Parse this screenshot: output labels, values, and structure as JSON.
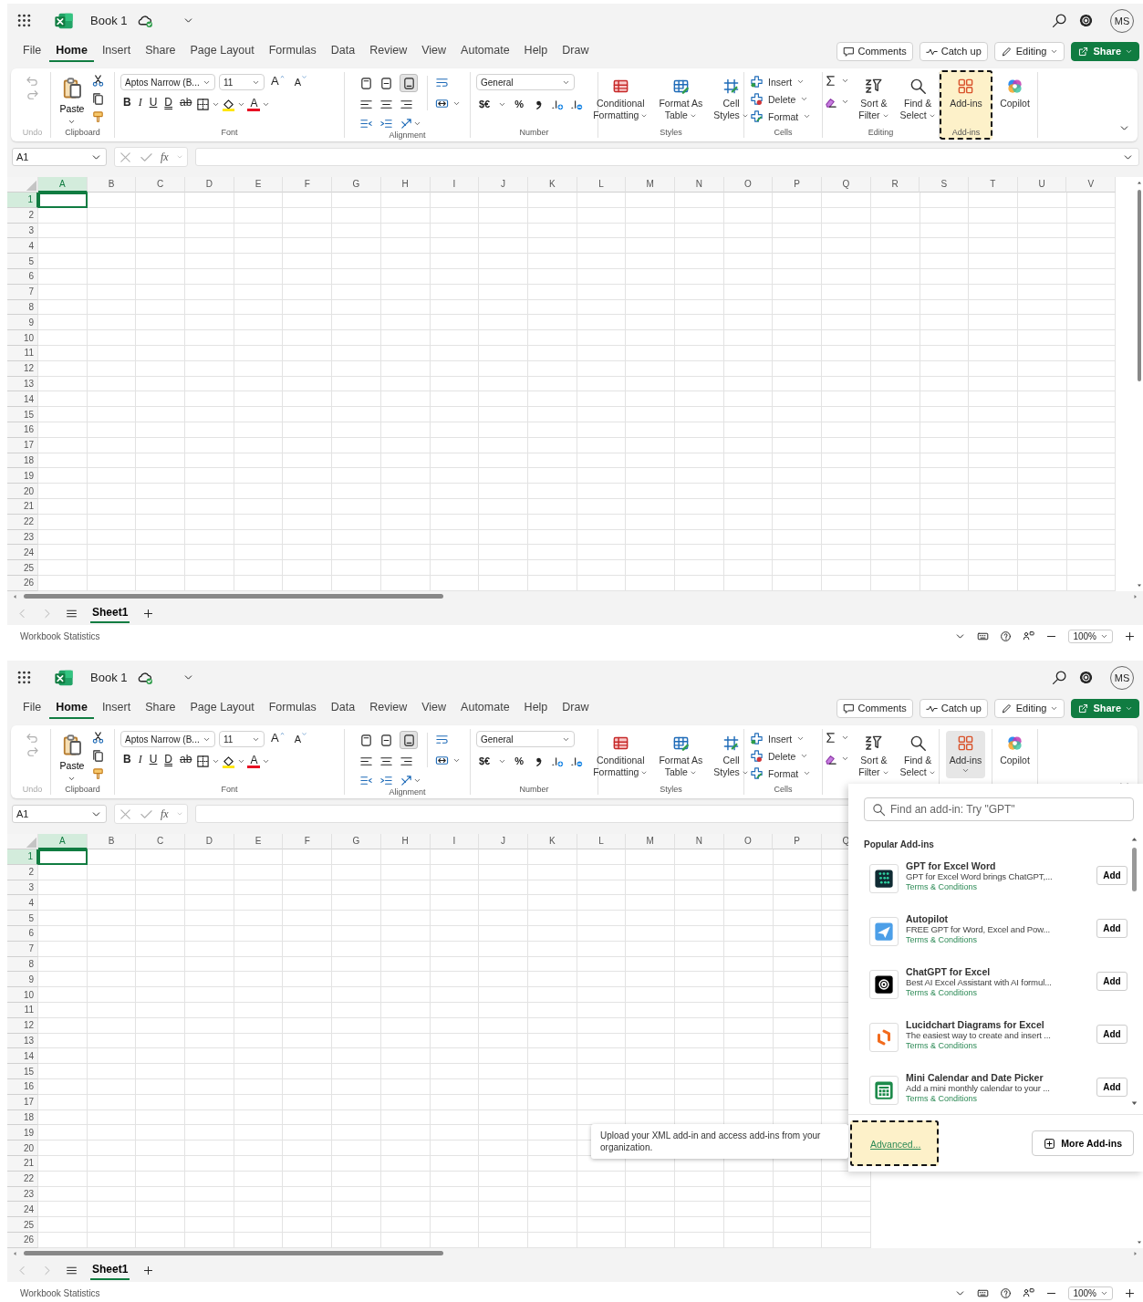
{
  "screens": [
    {
      "title_bar": {
        "document": "Book 1",
        "avatar": "MS"
      },
      "menu_tabs": [
        {
          "label": "File",
          "selected": false
        },
        {
          "label": "Home",
          "selected": true
        },
        {
          "label": "Insert",
          "selected": false
        },
        {
          "label": "Share",
          "selected": false
        },
        {
          "label": "Page Layout",
          "selected": false
        },
        {
          "label": "Formulas",
          "selected": false
        },
        {
          "label": "Data",
          "selected": false
        },
        {
          "label": "Review",
          "selected": false
        },
        {
          "label": "View",
          "selected": false
        },
        {
          "label": "Automate",
          "selected": false
        },
        {
          "label": "Help",
          "selected": false
        },
        {
          "label": "Draw",
          "selected": false
        }
      ],
      "header_buttons": [
        {
          "label": "Comments",
          "kind": "comments"
        },
        {
          "label": "Catch up",
          "kind": "catchup"
        },
        {
          "label": "Editing",
          "kind": "editing"
        },
        {
          "label": "Share",
          "kind": "share"
        }
      ],
      "ribbon": {
        "undo": {
          "label": "Undo"
        },
        "clipboard": {
          "paste": "Paste",
          "label": "Clipboard"
        },
        "font": {
          "family": "Aptos Narrow (B...",
          "size": "11",
          "grow": "A",
          "shrink": "A",
          "bold": "B",
          "italic": "I",
          "underline": "U",
          "double_underline": "D",
          "strikethrough": "ab",
          "color_button": "A",
          "label": "Font"
        },
        "alignment": {
          "label": "Alignment"
        },
        "number": {
          "format": "General",
          "currency": "$€",
          "percent": "%",
          "label": "Number"
        },
        "styles": {
          "buttons": [
            {
              "lines": [
                "Conditional",
                "Formatting"
              ],
              "kind": "conditional"
            },
            {
              "lines": [
                "Format As",
                "Table"
              ],
              "kind": "table"
            },
            {
              "lines": [
                "Cell",
                "Styles"
              ],
              "kind": "cell_styles"
            }
          ],
          "label": "Styles"
        },
        "cells": {
          "buttons": [
            {
              "label": "Insert",
              "kind": "insert"
            },
            {
              "label": "Delete",
              "kind": "delete"
            },
            {
              "label": "Format",
              "kind": "format"
            }
          ],
          "label": "Cells"
        },
        "editing": {
          "buttons": [
            {
              "lines": [
                "Sort &",
                "Filter"
              ],
              "kind": "sort"
            },
            {
              "lines": [
                "Find &",
                "Select"
              ],
              "kind": "find"
            }
          ],
          "label": "Editing"
        },
        "addins": {
          "button": "Add-ins",
          "label": "Add-ins",
          "expanded": false,
          "highlighted": true
        },
        "copilot": {
          "button": "Copilot"
        }
      },
      "formula_bar": {
        "name_box": "A1",
        "fx": "fx"
      },
      "columns": [
        {
          "label": "A",
          "selected": true
        },
        {
          "label": "B",
          "selected": false
        },
        {
          "label": "C",
          "selected": false
        },
        {
          "label": "D",
          "selected": false
        },
        {
          "label": "E",
          "selected": false
        },
        {
          "label": "F",
          "selected": false
        },
        {
          "label": "G",
          "selected": false
        },
        {
          "label": "H",
          "selected": false
        },
        {
          "label": "I",
          "selected": false
        },
        {
          "label": "J",
          "selected": false
        },
        {
          "label": "K",
          "selected": false
        },
        {
          "label": "L",
          "selected": false
        },
        {
          "label": "M",
          "selected": false
        },
        {
          "label": "N",
          "selected": false
        },
        {
          "label": "O",
          "selected": false
        },
        {
          "label": "P",
          "selected": false
        },
        {
          "label": "Q",
          "selected": false
        },
        {
          "label": "R",
          "selected": false
        },
        {
          "label": "S",
          "selected": false
        },
        {
          "label": "T",
          "selected": false
        },
        {
          "label": "U",
          "selected": false
        },
        {
          "label": "V",
          "selected": false
        }
      ],
      "rows": [
        {
          "label": "1",
          "selected": true
        },
        {
          "label": "2",
          "selected": false
        },
        {
          "label": "3",
          "selected": false
        },
        {
          "label": "4",
          "selected": false
        },
        {
          "label": "5",
          "selected": false
        },
        {
          "label": "6",
          "selected": false
        },
        {
          "label": "7",
          "selected": false
        },
        {
          "label": "8",
          "selected": false
        },
        {
          "label": "9",
          "selected": false
        },
        {
          "label": "10",
          "selected": false
        },
        {
          "label": "11",
          "selected": false
        },
        {
          "label": "12",
          "selected": false
        },
        {
          "label": "13",
          "selected": false
        },
        {
          "label": "14",
          "selected": false
        },
        {
          "label": "15",
          "selected": false
        },
        {
          "label": "16",
          "selected": false
        },
        {
          "label": "17",
          "selected": false
        },
        {
          "label": "18",
          "selected": false
        },
        {
          "label": "19",
          "selected": false
        },
        {
          "label": "20",
          "selected": false
        },
        {
          "label": "21",
          "selected": false
        },
        {
          "label": "22",
          "selected": false
        },
        {
          "label": "23",
          "selected": false
        },
        {
          "label": "24",
          "selected": false
        },
        {
          "label": "25",
          "selected": false
        },
        {
          "label": "26",
          "selected": false
        }
      ],
      "sheet_tabs": [
        {
          "label": "Sheet1",
          "selected": true
        }
      ],
      "status_bar": {
        "text": "Workbook Statistics",
        "zoom": "100%"
      }
    },
    {
      "title_bar": {
        "document": "Book 1",
        "avatar": "MS"
      },
      "menu_tabs": [
        {
          "label": "File",
          "selected": false
        },
        {
          "label": "Home",
          "selected": true
        },
        {
          "label": "Insert",
          "selected": false
        },
        {
          "label": "Share",
          "selected": false
        },
        {
          "label": "Page Layout",
          "selected": false
        },
        {
          "label": "Formulas",
          "selected": false
        },
        {
          "label": "Data",
          "selected": false
        },
        {
          "label": "Review",
          "selected": false
        },
        {
          "label": "View",
          "selected": false
        },
        {
          "label": "Automate",
          "selected": false
        },
        {
          "label": "Help",
          "selected": false
        },
        {
          "label": "Draw",
          "selected": false
        }
      ],
      "header_buttons": [
        {
          "label": "Comments",
          "kind": "comments"
        },
        {
          "label": "Catch up",
          "kind": "catchup"
        },
        {
          "label": "Editing",
          "kind": "editing"
        },
        {
          "label": "Share",
          "kind": "share"
        }
      ],
      "ribbon": {
        "undo": {
          "label": "Undo"
        },
        "clipboard": {
          "paste": "Paste",
          "label": "Clipboard"
        },
        "font": {
          "family": "Aptos Narrow (B...",
          "size": "11",
          "grow": "A",
          "shrink": "A",
          "bold": "B",
          "italic": "I",
          "underline": "U",
          "double_underline": "D",
          "strikethrough": "ab",
          "color_button": "A",
          "label": "Font"
        },
        "alignment": {
          "label": "Alignment"
        },
        "number": {
          "format": "General",
          "currency": "$€",
          "percent": "%",
          "label": "Number"
        },
        "styles": {
          "buttons": [
            {
              "lines": [
                "Conditional",
                "Formatting"
              ],
              "kind": "conditional"
            },
            {
              "lines": [
                "Format As",
                "Table"
              ],
              "kind": "table"
            },
            {
              "lines": [
                "Cell",
                "Styles"
              ],
              "kind": "cell_styles"
            }
          ],
          "label": "Styles"
        },
        "cells": {
          "buttons": [
            {
              "label": "Insert",
              "kind": "insert"
            },
            {
              "label": "Delete",
              "kind": "delete"
            },
            {
              "label": "Format",
              "kind": "format"
            }
          ],
          "label": "Cells"
        },
        "editing": {
          "buttons": [
            {
              "lines": [
                "Sort &",
                "Filter"
              ],
              "kind": "sort"
            },
            {
              "lines": [
                "Find &",
                "Select"
              ],
              "kind": "find"
            }
          ]
        },
        "addins": {
          "button": "Add-ins",
          "expanded": true,
          "highlighted": false
        },
        "copilot": {
          "button": "Copilot"
        }
      },
      "formula_bar": {
        "name_box": "A1",
        "fx": "fx"
      },
      "columns": [
        {
          "label": "A",
          "selected": true
        },
        {
          "label": "B",
          "selected": false
        },
        {
          "label": "C",
          "selected": false
        },
        {
          "label": "D",
          "selected": false
        },
        {
          "label": "E",
          "selected": false
        },
        {
          "label": "F",
          "selected": false
        },
        {
          "label": "G",
          "selected": false
        },
        {
          "label": "H",
          "selected": false
        },
        {
          "label": "I",
          "selected": false
        },
        {
          "label": "J",
          "selected": false
        },
        {
          "label": "K",
          "selected": false
        },
        {
          "label": "L",
          "selected": false
        },
        {
          "label": "M",
          "selected": false
        },
        {
          "label": "N",
          "selected": false
        },
        {
          "label": "O",
          "selected": false
        },
        {
          "label": "P",
          "selected": false
        },
        {
          "label": "Q",
          "selected": false
        }
      ],
      "rows": [
        {
          "label": "1",
          "selected": true
        },
        {
          "label": "2",
          "selected": false
        },
        {
          "label": "3",
          "selected": false
        },
        {
          "label": "4",
          "selected": false
        },
        {
          "label": "5",
          "selected": false
        },
        {
          "label": "6",
          "selected": false
        },
        {
          "label": "7",
          "selected": false
        },
        {
          "label": "8",
          "selected": false
        },
        {
          "label": "9",
          "selected": false
        },
        {
          "label": "10",
          "selected": false
        },
        {
          "label": "11",
          "selected": false
        },
        {
          "label": "12",
          "selected": false
        },
        {
          "label": "13",
          "selected": false
        },
        {
          "label": "14",
          "selected": false
        },
        {
          "label": "15",
          "selected": false
        },
        {
          "label": "16",
          "selected": false
        },
        {
          "label": "17",
          "selected": false
        },
        {
          "label": "18",
          "selected": false
        },
        {
          "label": "19",
          "selected": false
        },
        {
          "label": "20",
          "selected": false
        },
        {
          "label": "21",
          "selected": false
        },
        {
          "label": "22",
          "selected": false
        },
        {
          "label": "23",
          "selected": false
        },
        {
          "label": "24",
          "selected": false
        },
        {
          "label": "25",
          "selected": false
        },
        {
          "label": "26",
          "selected": false
        }
      ],
      "sheet_tabs": [
        {
          "label": "Sheet1",
          "selected": true
        }
      ],
      "status_bar": {
        "text": "Workbook Statistics",
        "zoom": "100%"
      },
      "addins_panel": {
        "search_placeholder": "Find an add-in: Try \"GPT\"",
        "heading": "Popular Add-ins",
        "items": [
          {
            "name": "GPT for Excel Word",
            "description": "GPT for Excel Word brings ChatGPT,...",
            "terms": "Terms & Conditions",
            "button": "Add",
            "kind": "gpt_word"
          },
          {
            "name": "Autopilot",
            "description": "FREE GPT for Word, Excel and Pow...",
            "terms": "Terms & Conditions",
            "button": "Add",
            "kind": "autopilot"
          },
          {
            "name": "ChatGPT for Excel",
            "description": "Best AI Excel Assistant with AI formul...",
            "terms": "Terms & Conditions",
            "button": "Add",
            "kind": "chatgpt"
          },
          {
            "name": "Lucidchart Diagrams for Excel",
            "description": "The easiest way to create and insert ...",
            "terms": "Terms & Conditions",
            "button": "Add",
            "kind": "lucidchart"
          },
          {
            "name": "Mini Calendar and Date Picker",
            "description": "Add a mini monthly calendar to your ...",
            "terms": "Terms & Conditions",
            "button": "Add",
            "kind": "calendar"
          }
        ],
        "tooltip": "Upload your XML add-in and access add-ins from your organization.",
        "advanced": {
          "label": "Advanced...",
          "highlighted": true
        },
        "more_button": "More Add-ins"
      }
    }
  ]
}
